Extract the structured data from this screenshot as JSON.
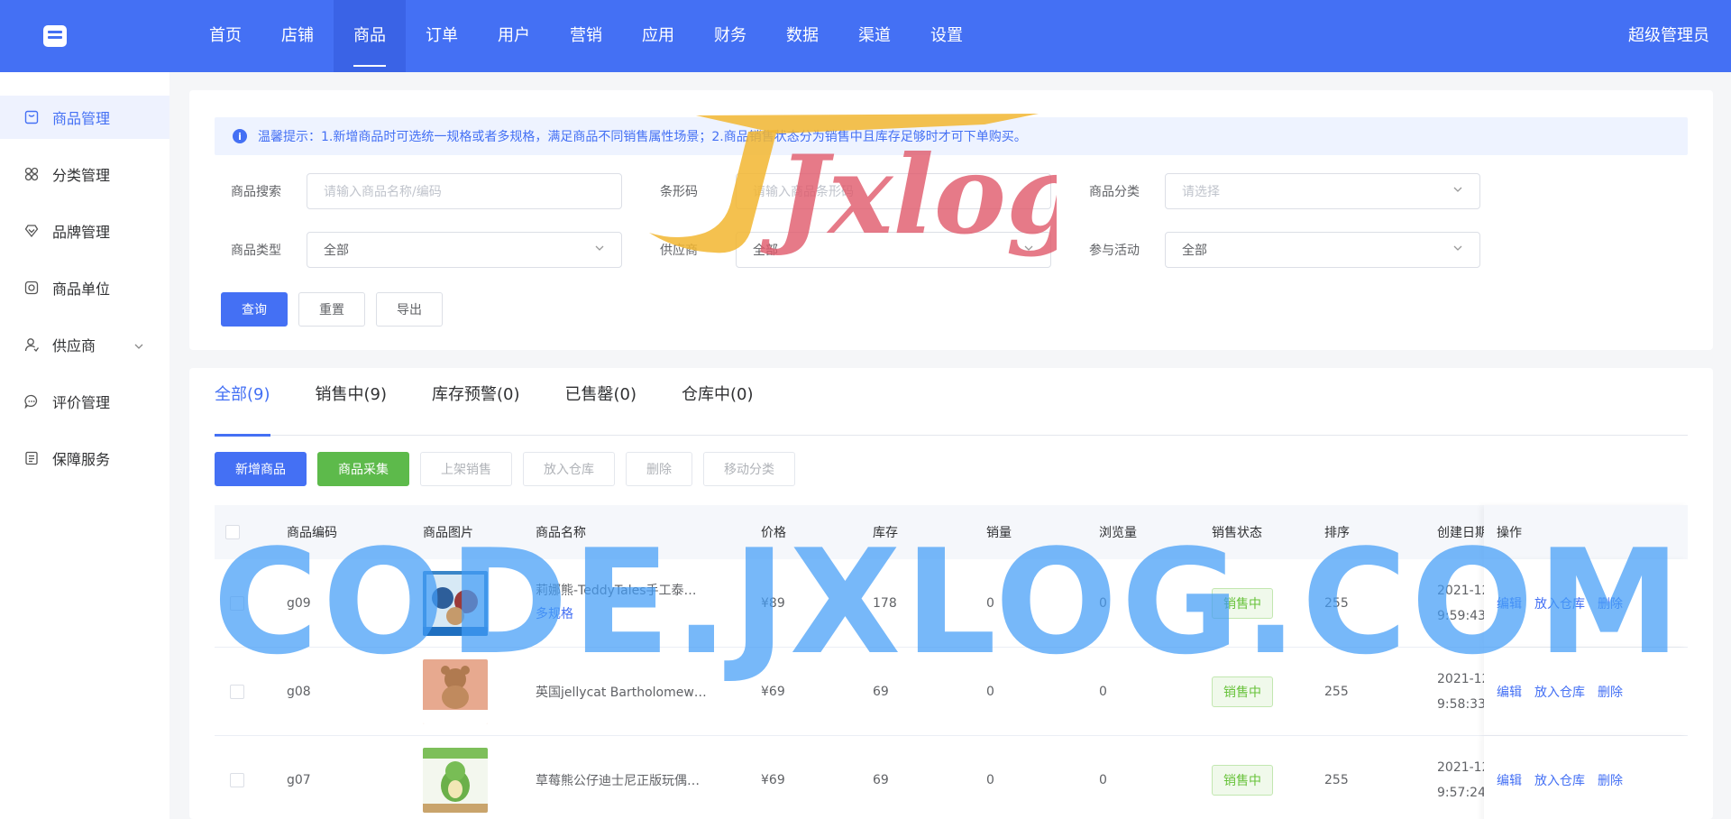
{
  "topbar": {
    "nav": [
      "首页",
      "店铺",
      "商品",
      "订单",
      "用户",
      "营销",
      "应用",
      "财务",
      "数据",
      "渠道",
      "设置"
    ],
    "active_index": 2,
    "user": "超级管理员"
  },
  "sidebar": {
    "items": [
      {
        "label": "商品管理",
        "icon": "goods-icon"
      },
      {
        "label": "分类管理",
        "icon": "category-icon"
      },
      {
        "label": "品牌管理",
        "icon": "brand-icon"
      },
      {
        "label": "商品单位",
        "icon": "unit-icon"
      },
      {
        "label": "供应商",
        "icon": "supplier-icon"
      },
      {
        "label": "评价管理",
        "icon": "comment-icon"
      },
      {
        "label": "保障服务",
        "icon": "service-icon"
      }
    ]
  },
  "tip": "温馨提示：1.新增商品时可选统一规格或者多规格，满足商品不同销售属性场景；2.商品销售状态分为销售中且库存足够时才可下单购买。",
  "filters": {
    "search": {
      "label": "商品搜索",
      "placeholder": "请输入商品名称/编码"
    },
    "barcode": {
      "label": "条形码",
      "placeholder": "请输入商品条形码"
    },
    "category": {
      "label": "商品分类",
      "placeholder": "请选择"
    },
    "type": {
      "label": "商品类型",
      "value": "全部"
    },
    "supplier": {
      "label": "供应商",
      "value": "全部"
    },
    "activity": {
      "label": "参与活动",
      "value": "全部"
    },
    "buttons": {
      "query": "查询",
      "reset": "重置",
      "export": "导出"
    }
  },
  "tabs": [
    "全部(9)",
    "销售中(9)",
    "库存预警(0)",
    "已售罄(0)",
    "仓库中(0)"
  ],
  "actions": {
    "add": "新增商品",
    "collect": "商品采集",
    "on_sale": "上架销售",
    "to_warehouse": "放入仓库",
    "delete": "删除",
    "move_category": "移动分类"
  },
  "table": {
    "headers": {
      "code": "商品编码",
      "image": "商品图片",
      "name": "商品名称",
      "price": "价格",
      "stock": "库存",
      "sales": "销量",
      "views": "浏览量",
      "status": "销售状态",
      "sort": "排序",
      "created": "创建日期",
      "ops": "操作"
    },
    "rows": [
      {
        "code": "g09",
        "name": "莉娜熊-TeddyTales手工泰…",
        "spec": "多规格",
        "price": "¥89",
        "stock": "178",
        "sales": "0",
        "views": "0",
        "status": "销售中",
        "sort": "255",
        "date1": "2021-12",
        "date2": "9:59:43"
      },
      {
        "code": "g08",
        "name": "英国jellycat Bartholomew…",
        "spec": "",
        "price": "¥69",
        "stock": "69",
        "sales": "0",
        "views": "0",
        "status": "销售中",
        "sort": "255",
        "date1": "2021-12",
        "date2": "9:58:33"
      },
      {
        "code": "g07",
        "name": "草莓熊公仔迪士尼正版玩偶…",
        "spec": "",
        "price": "¥69",
        "stock": "69",
        "sales": "0",
        "views": "0",
        "status": "销售中",
        "sort": "255",
        "date1": "2021-12",
        "date2": "9:57:24"
      }
    ],
    "row_ops": {
      "edit": "编辑",
      "warehouse": "放入仓库",
      "delete": "删除"
    }
  },
  "watermarks": {
    "logo": "Jxlog",
    "banner": "CODE.JXLOG.COM"
  },
  "colors": {
    "primary": "#4470f4",
    "success": "#5dba4b",
    "watermark_blue": "#429cf6",
    "watermark_red": "#e05a6b",
    "watermark_gold": "#f2b630"
  }
}
